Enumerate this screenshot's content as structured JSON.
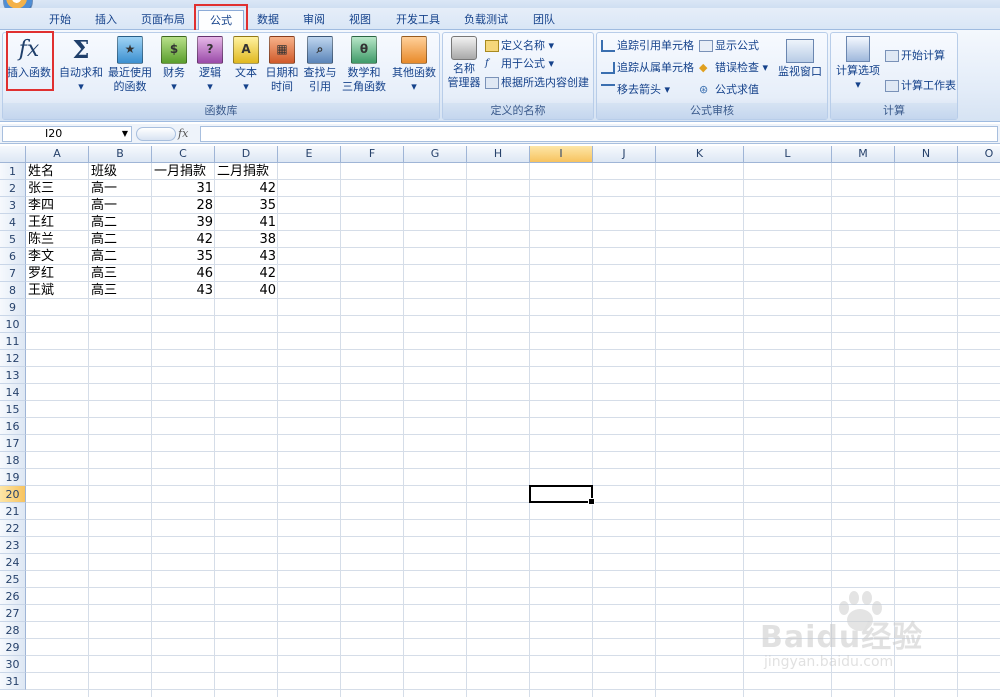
{
  "tabs": [
    {
      "label": "开始",
      "active": false
    },
    {
      "label": "插入",
      "active": false
    },
    {
      "label": "页面布局",
      "active": false
    },
    {
      "label": "公式",
      "active": true
    },
    {
      "label": "数据",
      "active": false
    },
    {
      "label": "审阅",
      "active": false
    },
    {
      "label": "视图",
      "active": false
    },
    {
      "label": "开发工具",
      "active": false
    },
    {
      "label": "负载测试",
      "active": false
    },
    {
      "label": "团队",
      "active": false
    }
  ],
  "ribbon": {
    "function_library": {
      "title": "函数库",
      "insert_function": "插入函数",
      "autosum": "自动求和",
      "recent": [
        "最近使用",
        "的函数"
      ],
      "financial": "财务",
      "logical": "逻辑",
      "text": "文本",
      "datetime": [
        "日期和",
        "时间"
      ],
      "lookup": [
        "查找与",
        "引用"
      ],
      "math": [
        "数学和",
        "三角函数"
      ],
      "more": "其他函数"
    },
    "defined_names": {
      "title": "定义的名称",
      "name_manager": [
        "名称",
        "管理器"
      ],
      "define_name": "定义名称",
      "use_in_formula": "用于公式",
      "create_from_selection": "根据所选内容创建"
    },
    "formula_auditing": {
      "title": "公式审核",
      "trace_precedents": "追踪引用单元格",
      "trace_dependents": "追踪从属单元格",
      "remove_arrows": "移去箭头",
      "show_formulas": "显示公式",
      "error_checking": "错误检查",
      "evaluate_formula": "公式求值",
      "watch_window": "监视窗口"
    },
    "calculation": {
      "title": "计算",
      "calc_options": "计算选项",
      "calc_now": "开始计算",
      "calc_sheet": "计算工作表"
    }
  },
  "formula_bar": {
    "name_box": "I20",
    "fx": "fx",
    "value": ""
  },
  "sheet": {
    "columns": [
      "A",
      "B",
      "C",
      "D",
      "E",
      "F",
      "G",
      "H",
      "I",
      "J",
      "K",
      "L",
      "M",
      "N",
      "O"
    ],
    "rows": [
      "1",
      "2",
      "3",
      "4",
      "5",
      "6",
      "7",
      "8",
      "9",
      "10",
      "11",
      "12",
      "13",
      "14",
      "15",
      "16",
      "17",
      "18",
      "19",
      "20",
      "21",
      "22",
      "23",
      "24",
      "25",
      "26",
      "27",
      "28",
      "29",
      "30",
      "31"
    ],
    "selected_cell": "I20",
    "table": {
      "headers": [
        "姓名",
        "班级",
        "一月捐款",
        "二月捐款"
      ],
      "rows": [
        [
          "张三",
          "高一",
          "31",
          "42"
        ],
        [
          "李四",
          "高一",
          "28",
          "35"
        ],
        [
          "王红",
          "高二",
          "39",
          "41"
        ],
        [
          "陈兰",
          "高二",
          "42",
          "38"
        ],
        [
          "李文",
          "高二",
          "35",
          "43"
        ],
        [
          "罗红",
          "高三",
          "46",
          "42"
        ],
        [
          "王斌",
          "高三",
          "43",
          "40"
        ]
      ]
    }
  },
  "watermark": {
    "brand": "Baidu经验",
    "url": "jingyan.baidu.com"
  },
  "colors": {
    "highlight_box": "#e03030",
    "ribbon_text": "#15428b",
    "selected_header": "#f7c35f"
  }
}
